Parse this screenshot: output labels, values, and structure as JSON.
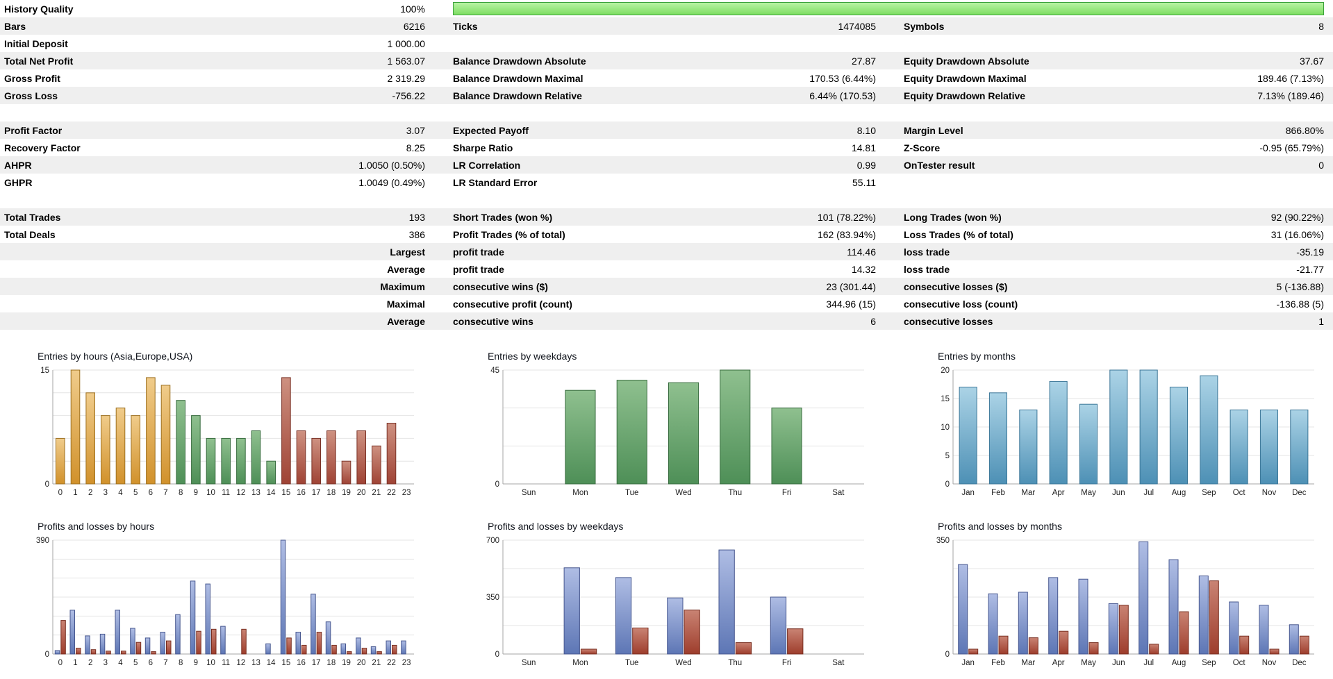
{
  "table": {
    "rows": [
      {
        "kind": "progress",
        "shade": false,
        "label": "History Quality",
        "value": "100%",
        "percent": 100
      },
      {
        "kind": "data",
        "shade": true,
        "c": [
          [
            "Bars",
            "6216"
          ],
          [
            "Ticks",
            "1474085"
          ],
          [
            "Symbols",
            "8"
          ]
        ]
      },
      {
        "kind": "data",
        "shade": false,
        "c": [
          [
            "Initial Deposit",
            "1 000.00"
          ],
          [
            "",
            ""
          ],
          [
            "",
            ""
          ]
        ]
      },
      {
        "kind": "data",
        "shade": true,
        "c": [
          [
            "Total Net Profit",
            "1 563.07"
          ],
          [
            "Balance Drawdown Absolute",
            "27.87"
          ],
          [
            "Equity Drawdown Absolute",
            "37.67"
          ]
        ]
      },
      {
        "kind": "data",
        "shade": false,
        "c": [
          [
            "Gross Profit",
            "2 319.29"
          ],
          [
            "Balance Drawdown Maximal",
            "170.53 (6.44%)"
          ],
          [
            "Equity Drawdown Maximal",
            "189.46 (7.13%)"
          ]
        ]
      },
      {
        "kind": "data",
        "shade": true,
        "c": [
          [
            "Gross Loss",
            "-756.22"
          ],
          [
            "Balance Drawdown Relative",
            "6.44% (170.53)"
          ],
          [
            "Equity Drawdown Relative",
            "7.13% (189.46)"
          ]
        ]
      },
      {
        "kind": "spacer",
        "shade": false
      },
      {
        "kind": "data",
        "shade": true,
        "c": [
          [
            "Profit Factor",
            "3.07"
          ],
          [
            "Expected Payoff",
            "8.10"
          ],
          [
            "Margin Level",
            "866.80%"
          ]
        ]
      },
      {
        "kind": "data",
        "shade": false,
        "c": [
          [
            "Recovery Factor",
            "8.25"
          ],
          [
            "Sharpe Ratio",
            "14.81"
          ],
          [
            "Z-Score",
            "-0.95 (65.79%)"
          ]
        ]
      },
      {
        "kind": "data",
        "shade": true,
        "c": [
          [
            "AHPR",
            "1.0050 (0.50%)"
          ],
          [
            "LR Correlation",
            "0.99"
          ],
          [
            "OnTester result",
            "0"
          ]
        ]
      },
      {
        "kind": "data",
        "shade": false,
        "c": [
          [
            "GHPR",
            "1.0049 (0.49%)"
          ],
          [
            "LR Standard Error",
            "55.11"
          ],
          [
            "",
            ""
          ]
        ]
      },
      {
        "kind": "spacer",
        "shade": false
      },
      {
        "kind": "data",
        "shade": true,
        "c": [
          [
            "Total Trades",
            "193"
          ],
          [
            "Short Trades (won %)",
            "101 (78.22%)"
          ],
          [
            "Long Trades (won %)",
            "92 (90.22%)"
          ]
        ]
      },
      {
        "kind": "data",
        "shade": false,
        "c": [
          [
            "Total Deals",
            "386"
          ],
          [
            "Profit Trades (% of total)",
            "162 (83.94%)"
          ],
          [
            "Loss Trades (% of total)",
            "31 (16.06%)"
          ]
        ]
      },
      {
        "kind": "data",
        "shade": true,
        "v1label": true,
        "c": [
          [
            "",
            "Largest"
          ],
          [
            "profit trade",
            "114.46"
          ],
          [
            "loss trade",
            "-35.19"
          ]
        ]
      },
      {
        "kind": "data",
        "shade": false,
        "v1label": true,
        "c": [
          [
            "",
            "Average"
          ],
          [
            "profit trade",
            "14.32"
          ],
          [
            "loss trade",
            "-21.77"
          ]
        ]
      },
      {
        "kind": "data",
        "shade": true,
        "v1label": true,
        "c": [
          [
            "",
            "Maximum"
          ],
          [
            "consecutive wins ($)",
            "23 (301.44)"
          ],
          [
            "consecutive losses ($)",
            "5 (-136.88)"
          ]
        ]
      },
      {
        "kind": "data",
        "shade": false,
        "v1label": true,
        "c": [
          [
            "",
            "Maximal"
          ],
          [
            "consecutive profit (count)",
            "344.96 (15)"
          ],
          [
            "consecutive loss (count)",
            "-136.88 (5)"
          ]
        ]
      },
      {
        "kind": "data",
        "shade": true,
        "v1label": true,
        "c": [
          [
            "",
            "Average"
          ],
          [
            "consecutive wins",
            "6"
          ],
          [
            "consecutive losses",
            "1"
          ]
        ]
      }
    ]
  },
  "palette": {
    "asia": {
      "top": "#f0cc8b",
      "bottom": "#d1912b",
      "stroke": "#9c6f1f"
    },
    "europe": {
      "top": "#8fc08f",
      "bottom": "#4e8f57",
      "stroke": "#376b3e"
    },
    "usa": {
      "top": "#ce9181",
      "bottom": "#9f4335",
      "stroke": "#7a3227"
    },
    "months_blue": {
      "top": "#abd3e6",
      "bottom": "#4d90b5",
      "stroke": "#3b7697"
    },
    "profit_blue": {
      "top": "#afbde4",
      "bottom": "#5d76b5",
      "stroke": "#47578f"
    },
    "loss_red": {
      "top": "#c98373",
      "bottom": "#9e3d2c",
      "stroke": "#782e20"
    }
  },
  "progress_colors": {
    "fill_top": "#b8f3a4",
    "fill_bottom": "#7ede62",
    "border": "#3aa23a"
  },
  "chart_data": [
    {
      "type": "bar",
      "title": "Entries by hours (Asia,Europe,USA)",
      "categories": [
        "0",
        "1",
        "2",
        "3",
        "4",
        "5",
        "6",
        "7",
        "8",
        "9",
        "10",
        "11",
        "12",
        "13",
        "14",
        "15",
        "16",
        "17",
        "18",
        "19",
        "20",
        "21",
        "22",
        "23"
      ],
      "ymax": 15,
      "yticks": [
        0,
        15
      ],
      "grid_div": 5,
      "bar_palettes": [
        "asia",
        "asia",
        "asia",
        "asia",
        "asia",
        "asia",
        "asia",
        "asia",
        "europe",
        "europe",
        "europe",
        "europe",
        "europe",
        "europe",
        "europe",
        "usa",
        "usa",
        "usa",
        "usa",
        "usa",
        "usa",
        "usa",
        "usa",
        "usa"
      ],
      "series": [
        {
          "name": "entries",
          "palette": "europe",
          "values": [
            6,
            15,
            12,
            9,
            10,
            9,
            14,
            13,
            11,
            9,
            6,
            6,
            6,
            7,
            3,
            14,
            7,
            6,
            7,
            3,
            7,
            5,
            8,
            0
          ]
        }
      ]
    },
    {
      "type": "bar",
      "title": "Entries by weekdays",
      "categories": [
        "Sun",
        "Mon",
        "Tue",
        "Wed",
        "Thu",
        "Fri",
        "Sat"
      ],
      "ymax": 45,
      "yticks": [
        0,
        45
      ],
      "grid_div": 3,
      "series": [
        {
          "name": "entries",
          "palette": "europe",
          "values": [
            0,
            37,
            41,
            40,
            45,
            30,
            0
          ]
        }
      ]
    },
    {
      "type": "bar",
      "title": "Entries by months",
      "categories": [
        "Jan",
        "Feb",
        "Mar",
        "Apr",
        "May",
        "Jun",
        "Jul",
        "Aug",
        "Sep",
        "Oct",
        "Nov",
        "Dec"
      ],
      "ymax": 20,
      "yticks": [
        0,
        5,
        10,
        15,
        20
      ],
      "grid_div": 4,
      "series": [
        {
          "name": "entries",
          "palette": "months_blue",
          "values": [
            17,
            16,
            13,
            18,
            14,
            20,
            20,
            17,
            19,
            13,
            13,
            13
          ]
        }
      ]
    },
    {
      "type": "bar",
      "title": "Profits and losses by hours",
      "categories": [
        "0",
        "1",
        "2",
        "3",
        "4",
        "5",
        "6",
        "7",
        "8",
        "9",
        "10",
        "11",
        "12",
        "13",
        "14",
        "15",
        "16",
        "17",
        "18",
        "19",
        "20",
        "21",
        "22",
        "23"
      ],
      "ymax": 390,
      "yticks": [
        0,
        390
      ],
      "grid_div": 6,
      "series": [
        {
          "name": "profit",
          "palette": "profit_blue",
          "values": [
            12,
            150,
            62,
            68,
            150,
            88,
            55,
            75,
            135,
            250,
            240,
            95,
            0,
            0,
            35,
            390,
            75,
            205,
            110,
            35,
            55,
            25,
            45,
            45
          ]
        },
        {
          "name": "loss",
          "palette": "loss_red",
          "values": [
            115,
            20,
            15,
            10,
            10,
            40,
            8,
            45,
            0,
            78,
            85,
            0,
            85,
            0,
            0,
            55,
            30,
            75,
            30,
            8,
            20,
            8,
            30,
            0
          ]
        }
      ]
    },
    {
      "type": "bar",
      "title": "Profits and losses by weekdays",
      "categories": [
        "Sun",
        "Mon",
        "Tue",
        "Wed",
        "Thu",
        "Fri",
        "Sat"
      ],
      "ymax": 700,
      "yticks": [
        0,
        350,
        700
      ],
      "grid_div": 4,
      "series": [
        {
          "name": "profit",
          "palette": "profit_blue",
          "values": [
            0,
            530,
            470,
            345,
            640,
            350,
            0
          ]
        },
        {
          "name": "loss",
          "palette": "loss_red",
          "values": [
            0,
            30,
            160,
            270,
            70,
            155,
            0
          ]
        }
      ]
    },
    {
      "type": "bar",
      "title": "Profits and losses by months",
      "categories": [
        "Jan",
        "Feb",
        "Mar",
        "Apr",
        "May",
        "Jun",
        "Jul",
        "Aug",
        "Sep",
        "Oct",
        "Nov",
        "Dec"
      ],
      "ymax": 350,
      "yticks": [
        0,
        350
      ],
      "grid_div": 4,
      "series": [
        {
          "name": "profit",
          "palette": "profit_blue",
          "values": [
            275,
            185,
            190,
            235,
            230,
            155,
            345,
            290,
            240,
            160,
            150,
            90
          ]
        },
        {
          "name": "loss",
          "palette": "loss_red",
          "values": [
            15,
            55,
            50,
            70,
            35,
            150,
            30,
            130,
            225,
            55,
            15,
            55
          ]
        }
      ]
    }
  ]
}
